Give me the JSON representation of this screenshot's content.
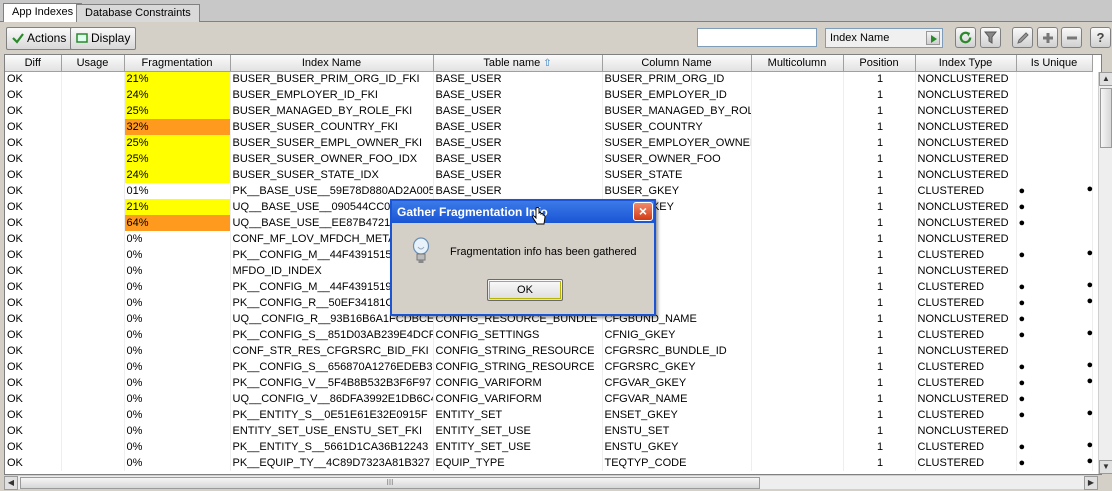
{
  "tabs": [
    {
      "label": "App Indexes",
      "active": true
    },
    {
      "label": "Database Constraints",
      "active": false
    }
  ],
  "toolbar": {
    "actions_label": "Actions",
    "display_label": "Display",
    "search_value": "",
    "column_select": "Index Name",
    "icons": [
      "refresh-icon",
      "filter-icon",
      "edit-icon",
      "add-icon",
      "remove-icon",
      "help-icon"
    ],
    "help_label": "?"
  },
  "table": {
    "columns": [
      "Diff",
      "Usage",
      "Fragmentation",
      "Index Name",
      "Table name",
      "Column Name",
      "Multicolumn",
      "Position",
      "Index Type",
      "Is Unique"
    ],
    "rows": [
      {
        "diff": "OK",
        "usage": "",
        "frag": "21%",
        "frag_color": "yellow",
        "index": "BUSER_BUSER_PRIM_ORG_ID_FKI",
        "table": "BASE_USER",
        "column": "BUSER_PRIM_ORG_ID",
        "multi": "",
        "pos": "1",
        "type": "NONCLUSTERED",
        "unique": "",
        "extra": ""
      },
      {
        "diff": "OK",
        "usage": "",
        "frag": "24%",
        "frag_color": "yellow",
        "index": "BUSER_EMPLOYER_ID_FKI",
        "table": "BASE_USER",
        "column": "BUSER_EMPLOYER_ID",
        "multi": "",
        "pos": "1",
        "type": "NONCLUSTERED",
        "unique": "",
        "extra": ""
      },
      {
        "diff": "OK",
        "usage": "",
        "frag": "25%",
        "frag_color": "yellow",
        "index": "BUSER_MANAGED_BY_ROLE_FKI",
        "table": "BASE_USER",
        "column": "BUSER_MANAGED_BY_ROLE",
        "multi": "",
        "pos": "1",
        "type": "NONCLUSTERED",
        "unique": "",
        "extra": ""
      },
      {
        "diff": "OK",
        "usage": "",
        "frag": "32%",
        "frag_color": "orange",
        "index": "BUSER_SUSER_COUNTRY_FKI",
        "table": "BASE_USER",
        "column": "SUSER_COUNTRY",
        "multi": "",
        "pos": "1",
        "type": "NONCLUSTERED",
        "unique": "",
        "extra": ""
      },
      {
        "diff": "OK",
        "usage": "",
        "frag": "25%",
        "frag_color": "yellow",
        "index": "BUSER_SUSER_EMPL_OWNER_FKI",
        "table": "BASE_USER",
        "column": "SUSER_EMPLOYER_OWNER",
        "multi": "",
        "pos": "1",
        "type": "NONCLUSTERED",
        "unique": "",
        "extra": ""
      },
      {
        "diff": "OK",
        "usage": "",
        "frag": "25%",
        "frag_color": "yellow",
        "index": "BUSER_SUSER_OWNER_FOO_IDX",
        "table": "BASE_USER",
        "column": "SUSER_OWNER_FOO",
        "multi": "",
        "pos": "1",
        "type": "NONCLUSTERED",
        "unique": "",
        "extra": ""
      },
      {
        "diff": "OK",
        "usage": "",
        "frag": "24%",
        "frag_color": "yellow",
        "index": "BUSER_SUSER_STATE_IDX",
        "table": "BASE_USER",
        "column": "SUSER_STATE",
        "multi": "",
        "pos": "1",
        "type": "NONCLUSTERED",
        "unique": "",
        "extra": ""
      },
      {
        "diff": "OK",
        "usage": "",
        "frag": "01%",
        "frag_color": "",
        "index": "PK__BASE_USE__59E78D880AD2A005",
        "table": "BASE_USER",
        "column": "BUSER_GKEY",
        "multi": "",
        "pos": "1",
        "type": "CLUSTERED",
        "unique": "●",
        "extra": "●"
      },
      {
        "diff": "OK",
        "usage": "",
        "frag": "21%",
        "frag_color": "yellow",
        "index": "UQ__BASE_USE__090544CC0DA",
        "table": "",
        "column": "ATION_GKEY",
        "multi": "",
        "pos": "1",
        "type": "NONCLUSTERED",
        "unique": "●",
        "extra": ""
      },
      {
        "diff": "OK",
        "usage": "",
        "frag": "64%",
        "frag_color": "orange",
        "index": "UQ__BASE_USE__EE87B472108E",
        "table": "",
        "column": "ERID",
        "multi": "",
        "pos": "1",
        "type": "NONCLUSTERED",
        "unique": "●",
        "extra": ""
      },
      {
        "diff": "OK",
        "usage": "",
        "frag": "0%",
        "frag_color": "",
        "index": "CONF_MF_LOV_MFDCH_METAF_",
        "table": "",
        "column": "TAFIELD",
        "multi": "",
        "pos": "1",
        "type": "NONCLUSTERED",
        "unique": "",
        "extra": ""
      },
      {
        "diff": "OK",
        "usage": "",
        "frag": "0%",
        "frag_color": "",
        "index": "PK__CONFIG_M__44F439151550",
        "table": "",
        "column": "",
        "multi": "",
        "pos": "1",
        "type": "CLUSTERED",
        "unique": "●",
        "extra": "●"
      },
      {
        "diff": "OK",
        "usage": "",
        "frag": "0%",
        "frag_color": "",
        "index": "MFDO_ID_INDEX",
        "table": "",
        "column": "",
        "multi": "",
        "pos": "1",
        "type": "NONCLUSTERED",
        "unique": "",
        "extra": ""
      },
      {
        "diff": "OK",
        "usage": "",
        "frag": "0%",
        "frag_color": "",
        "index": "PK__CONFIG_M__44F43915192",
        "table": "",
        "column": "",
        "multi": "",
        "pos": "1",
        "type": "CLUSTERED",
        "unique": "●",
        "extra": "●"
      },
      {
        "diff": "OK",
        "usage": "",
        "frag": "0%",
        "frag_color": "",
        "index": "PK__CONFIG_R__50EF34181CF1",
        "table": "",
        "column": "KEY",
        "multi": "",
        "pos": "1",
        "type": "CLUSTERED",
        "unique": "●",
        "extra": "●"
      },
      {
        "diff": "OK",
        "usage": "",
        "frag": "0%",
        "frag_color": "",
        "index": "UQ__CONFIG_R__93B16B6A1FCDBCEB",
        "table": "CONFIG_RESOURCE_BUNDLE",
        "column": "CFGBUND_NAME",
        "multi": "",
        "pos": "1",
        "type": "NONCLUSTERED",
        "unique": "●",
        "extra": ""
      },
      {
        "diff": "OK",
        "usage": "",
        "frag": "0%",
        "frag_color": "",
        "index": "PK__CONFIG_S__851D03AB239E4DCF",
        "table": "CONFIG_SETTINGS",
        "column": "CFNIG_GKEY",
        "multi": "",
        "pos": "1",
        "type": "CLUSTERED",
        "unique": "●",
        "extra": "●"
      },
      {
        "diff": "OK",
        "usage": "",
        "frag": "0%",
        "frag_color": "",
        "index": "CONF_STR_RES_CFGRSRC_BID_FKI",
        "table": "CONFIG_STRING_RESOURCE",
        "column": "CFGRSRC_BUNDLE_ID",
        "multi": "",
        "pos": "1",
        "type": "NONCLUSTERED",
        "unique": "",
        "extra": ""
      },
      {
        "diff": "OK",
        "usage": "",
        "frag": "0%",
        "frag_color": "",
        "index": "PK__CONFIG_S__656870A1276EDEB3",
        "table": "CONFIG_STRING_RESOURCE",
        "column": "CFGRSRC_GKEY",
        "multi": "",
        "pos": "1",
        "type": "CLUSTERED",
        "unique": "●",
        "extra": "●"
      },
      {
        "diff": "OK",
        "usage": "",
        "frag": "0%",
        "frag_color": "",
        "index": "PK__CONFIG_V__5F4B8B532B3F6F97",
        "table": "CONFIG_VARIFORM",
        "column": "CFGVAR_GKEY",
        "multi": "",
        "pos": "1",
        "type": "CLUSTERED",
        "unique": "●",
        "extra": "●"
      },
      {
        "diff": "OK",
        "usage": "",
        "frag": "0%",
        "frag_color": "",
        "index": "UQ__CONFIG_V__86DFA3992E1DB6C42",
        "table": "CONFIG_VARIFORM",
        "column": "CFGVAR_NAME",
        "multi": "",
        "pos": "1",
        "type": "NONCLUSTERED",
        "unique": "●",
        "extra": ""
      },
      {
        "diff": "OK",
        "usage": "",
        "frag": "0%",
        "frag_color": "",
        "index": "PK__ENTITY_S__0E51E61E32E0915F",
        "table": "ENTITY_SET",
        "column": "ENSET_GKEY",
        "multi": "",
        "pos": "1",
        "type": "CLUSTERED",
        "unique": "●",
        "extra": "●"
      },
      {
        "diff": "OK",
        "usage": "",
        "frag": "0%",
        "frag_color": "",
        "index": "ENTITY_SET_USE_ENSTU_SET_FKI",
        "table": "ENTITY_SET_USE",
        "column": "ENSTU_SET",
        "multi": "",
        "pos": "1",
        "type": "NONCLUSTERED",
        "unique": "",
        "extra": ""
      },
      {
        "diff": "OK",
        "usage": "",
        "frag": "0%",
        "frag_color": "",
        "index": "PK__ENTITY_S__5661D1CA36B12243",
        "table": "ENTITY_SET_USE",
        "column": "ENSTU_GKEY",
        "multi": "",
        "pos": "1",
        "type": "CLUSTERED",
        "unique": "●",
        "extra": "●"
      },
      {
        "diff": "OK",
        "usage": "",
        "frag": "0%",
        "frag_color": "",
        "index": "PK__EQUIP_TY__4C89D7323A81B327",
        "table": "EQUIP_TYPE",
        "column": "TEQTYP_CODE",
        "multi": "",
        "pos": "1",
        "type": "CLUSTERED",
        "unique": "●",
        "extra": "●"
      }
    ]
  },
  "colors": {
    "frag_yellow": "#ffff00",
    "frag_orange": "#ff9a1f",
    "dialog_title": "#1a55d4"
  },
  "dialog": {
    "title": "Gather Fragmentation Info",
    "message": "Fragmentation info has been gathered",
    "ok_label": "OK",
    "icon": "lightbulb-icon"
  },
  "scrollbar": {
    "grip": "III"
  }
}
